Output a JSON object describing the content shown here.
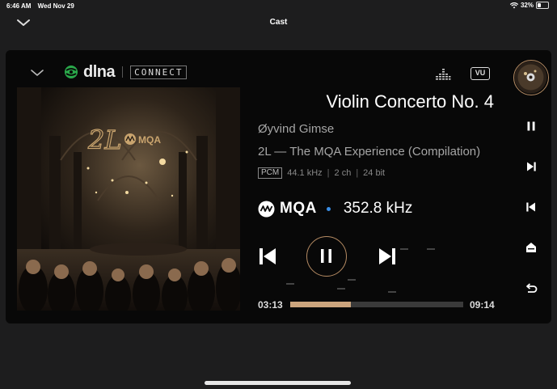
{
  "status": {
    "time": "6:46 AM",
    "date": "Wed Nov 29",
    "battery": "32%",
    "battery_level": 0.32
  },
  "header": {
    "title": "Cast"
  },
  "device": {
    "brand": "dlna",
    "badge": "CONNECT"
  },
  "toolbar": {
    "eq_icon": "equalizer-icon",
    "vu_label": "VU"
  },
  "track": {
    "title": "Violin Concerto No. 4",
    "artist": "Øyvind Gimse",
    "album": "2L — The MQA Experience (Compilation)"
  },
  "format": {
    "codec": "PCM",
    "sample_rate": "44.1 kHz",
    "channels": "2 ch",
    "bit_depth": "24 bit"
  },
  "mqa": {
    "label": "MQA",
    "rate": "352.8 kHz"
  },
  "art": {
    "label": "2L",
    "mqa_badge": "MQA"
  },
  "playback": {
    "elapsed": "03:13",
    "total": "09:14",
    "progress": 0.35
  },
  "side_controls": [
    "pause-icon",
    "next-icon",
    "previous-icon",
    "home-icon",
    "return-icon"
  ],
  "colors": {
    "accent": "#cba47d",
    "ring": "#b58b63",
    "mqa_dot": "#3a8ee6",
    "dlna_green": "#2aa84a"
  }
}
